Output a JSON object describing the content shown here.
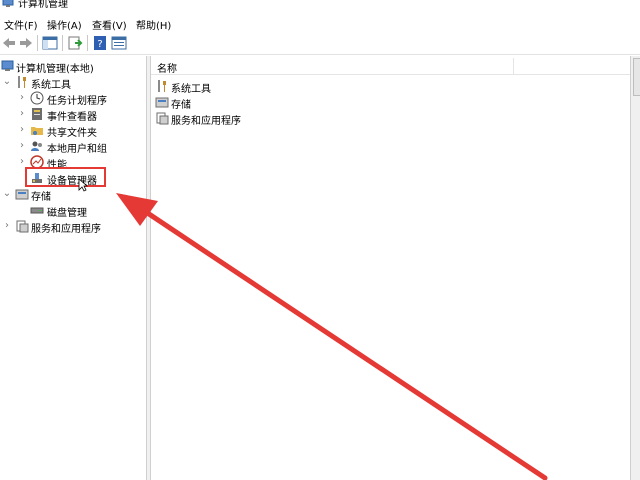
{
  "window": {
    "title": "计算机管理"
  },
  "menu": [
    {
      "label": "文件(F)"
    },
    {
      "label": "操作(A)"
    },
    {
      "label": "查看(V)"
    },
    {
      "label": "帮助(H)"
    }
  ],
  "toolbar": {
    "buttons": [
      {
        "icon": "back-arrow-icon"
      },
      {
        "icon": "forward-arrow-icon"
      },
      {
        "icon": "show-hide-tree-icon"
      },
      {
        "icon": "export-list-icon"
      },
      {
        "icon": "help-icon"
      },
      {
        "icon": "properties-icon"
      }
    ]
  },
  "tree": {
    "root": "计算机管理(本地)",
    "items": [
      {
        "label": "系统工具",
        "icon": "tools-icon",
        "expanded": true
      },
      {
        "label": "任务计划程序",
        "icon": "clock-icon"
      },
      {
        "label": "事件查看器",
        "icon": "event-viewer-icon"
      },
      {
        "label": "共享文件夹",
        "icon": "shared-folder-icon"
      },
      {
        "label": "本地用户和组",
        "icon": "users-icon"
      },
      {
        "label": "性能",
        "icon": "performance-icon"
      },
      {
        "label": "设备管理器",
        "icon": "device-manager-icon",
        "selected": true
      },
      {
        "label": "存储",
        "icon": "storage-icon",
        "expanded": true
      },
      {
        "label": "磁盘管理",
        "icon": "disk-icon"
      },
      {
        "label": "服务和应用程序",
        "icon": "services-icon"
      }
    ]
  },
  "list": {
    "column_name": "名称",
    "rows": [
      {
        "label": "系统工具",
        "icon": "tools-icon"
      },
      {
        "label": "存储",
        "icon": "storage-icon"
      },
      {
        "label": "服务和应用程序",
        "icon": "services-icon"
      }
    ]
  },
  "annotation": {
    "highlight_color": "#e53935"
  }
}
